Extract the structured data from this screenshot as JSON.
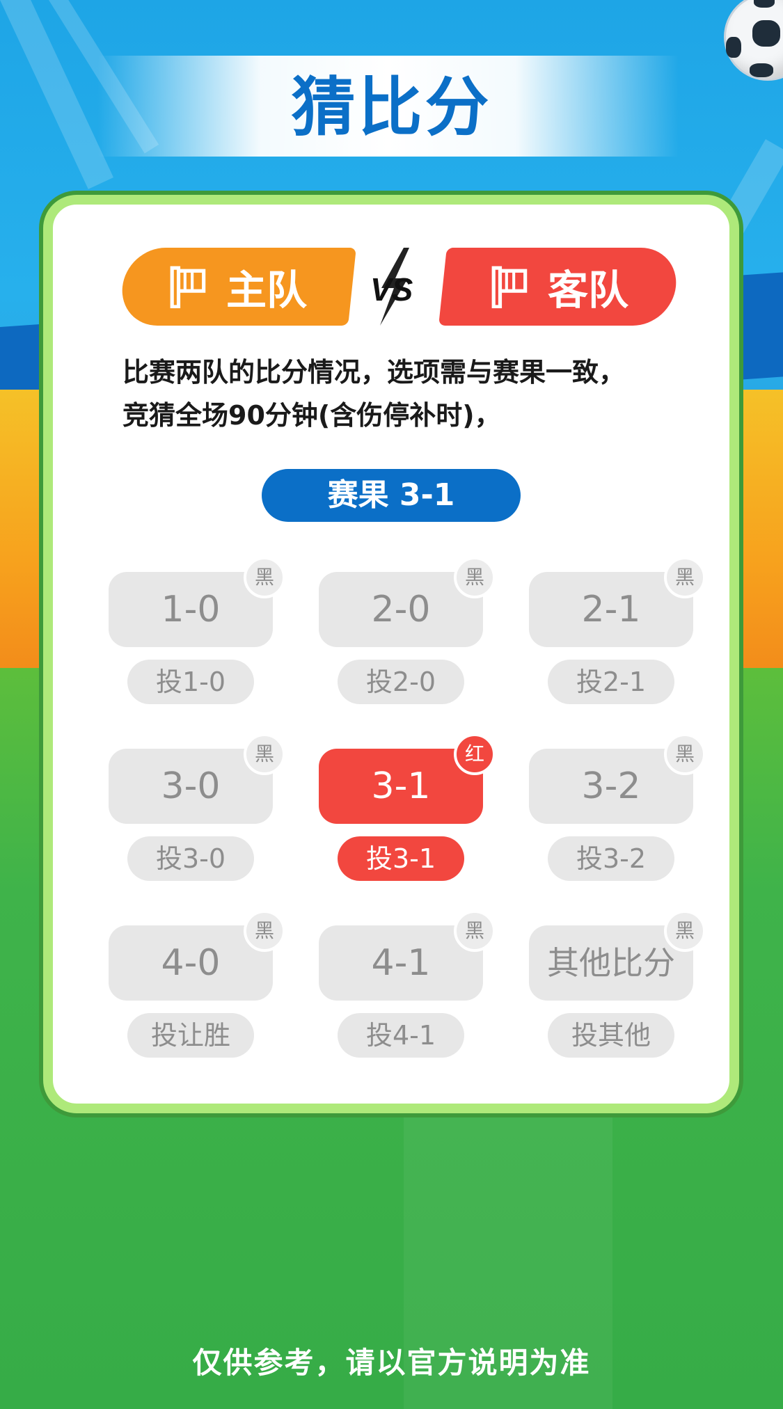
{
  "header": {
    "title": "猜比分"
  },
  "teams": {
    "home": "主队",
    "away": "客队"
  },
  "description": {
    "line1": "比赛两队的比分情况，选项需与赛果一致，",
    "line2": "竞猜全场90分钟(含伤停补时)，"
  },
  "result": {
    "label": "赛果 3-1"
  },
  "options": [
    {
      "score": "1-0",
      "badge": "黑",
      "bet": "投1-0"
    },
    {
      "score": "2-0",
      "badge": "黑",
      "bet": "投2-0"
    },
    {
      "score": "2-1",
      "badge": "黑",
      "bet": "投2-1"
    },
    {
      "score": "3-0",
      "badge": "黑",
      "bet": "投3-0"
    },
    {
      "score": "3-1",
      "badge": "红",
      "bet": "投3-1",
      "selected": true
    },
    {
      "score": "3-2",
      "badge": "黑",
      "bet": "投3-2"
    },
    {
      "score": "4-0",
      "badge": "黑",
      "bet": "投让胜"
    },
    {
      "score": "4-1",
      "badge": "黑",
      "bet": "投4-1"
    },
    {
      "score": "其他比分",
      "badge": "黑",
      "bet": "投其他"
    }
  ],
  "footer": {
    "disclaimer": "仅供参考，请以官方说明为准"
  },
  "colors": {
    "brand_blue": "#0b6fc7",
    "home": "#f6961f",
    "away": "#f2473f",
    "selected": "#f2473f",
    "neutral": "#e7e7e7"
  },
  "icons": {
    "flag": "flag-icon",
    "vs": "vs-icon",
    "ball": "soccer-ball-icon"
  }
}
